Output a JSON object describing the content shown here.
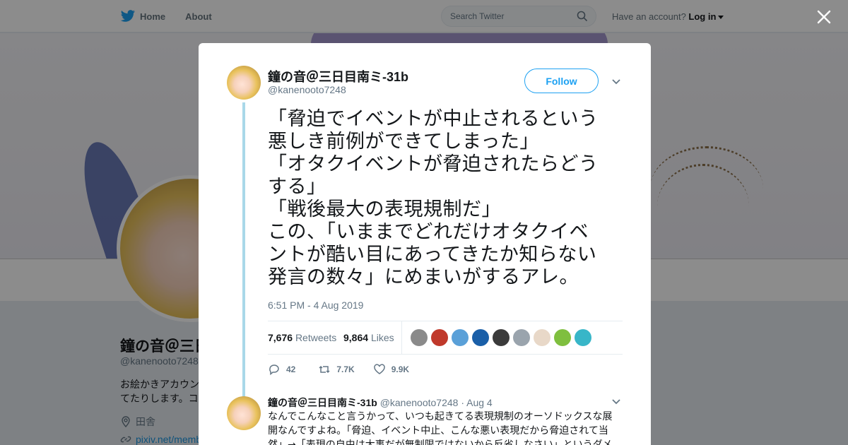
{
  "nav": {
    "home": "Home",
    "about": "About"
  },
  "search": {
    "placeholder": "Search Twitter"
  },
  "account": {
    "prompt": "Have an account?",
    "login": "Log in"
  },
  "profile": {
    "name": "鐘の音＠三日",
    "handle": "@kanenooto7248",
    "bio": "お絵かきアカウン てたりします。コ",
    "location": "田舎",
    "url": "pixiv.net/memb"
  },
  "tweet": {
    "author_name": "鐘の音＠三日目南ミ-31b",
    "author_handle": "@kanenooto7248",
    "follow_label": "Follow",
    "text": "「脅迫でイベントが中止されるという\n悪しき前例ができてしまった」\n「オタクイベントが脅迫されたらどう\nする」\n「戦後最大の表現規制だ」\nこの、「いままでどれだけオタクイベ\nントが酷い目にあってきたか知らない\n発言の数々」にめまいがするアレ。",
    "timestamp": "6:51 PM - 4 Aug 2019",
    "retweets_count": "7,676",
    "retweets_label": "Retweets",
    "likes_count": "9,864",
    "likes_label": "Likes",
    "liker_colors": [
      "#8a8a8a",
      "#c0392b",
      "#5aa0d8",
      "#1a5fa8",
      "#3b3b3b",
      "#9aa4ad",
      "#e8d8c8",
      "#7fbf3f",
      "#38b6c8"
    ],
    "replies": "42",
    "retweets_short": "7.7K",
    "likes_short": "9.9K"
  },
  "reply": {
    "author_name": "鐘の音＠三日目南ミ-31b",
    "author_handle": "@kanenooto7248",
    "date": "· Aug 4",
    "text": "なんでこんなこと言うかって、いつも起きてる表現規制のオーソドックスな展開なんですよね。「脅迫、イベント中止、こんな悪い表現だから脅迫されて当然」→「表現の自由は大事だが無制限ではないから反省しなさい」というダメ"
  },
  "colors": {
    "accent": "#1da1f2",
    "thread_line": "#a9d8e9",
    "overlay": "rgba(0,0,0,0.45)"
  }
}
